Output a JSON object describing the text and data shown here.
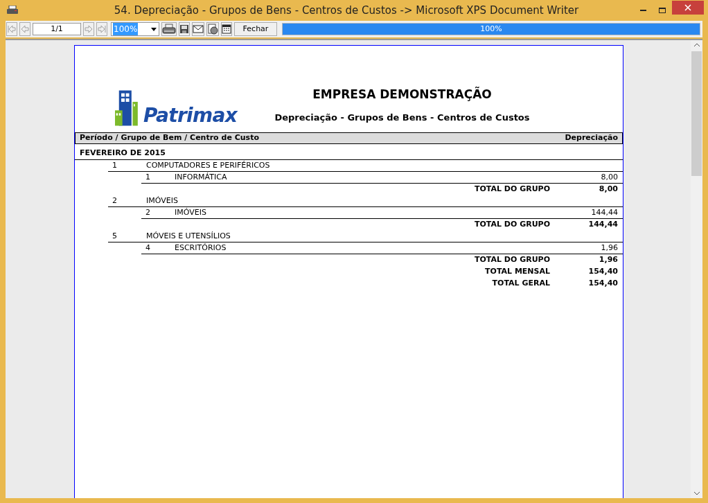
{
  "window": {
    "title": "54. Depreciação - Grupos de Bens - Centros de Custos -> Microsoft XPS Document Writer"
  },
  "toolbar": {
    "page": "1/1",
    "zoom": "100%",
    "close_label": "Fechar",
    "progress": {
      "level": 1,
      "reading": "100%"
    }
  },
  "report": {
    "logo_text": "Patrimax",
    "company": "EMPRESA DEMONSTRAÇÃO",
    "title": "Depreciação - Grupos de Bens - Centros de Custos",
    "columns": [
      "Período / Grupo de Bem / Centro de Custo",
      "Depreciação"
    ],
    "period": "FEVEREIRO DE 2015",
    "groups": [
      {
        "code": "1",
        "name": "COMPUTADORES E PERIFÉRICOS",
        "centers": [
          {
            "code": "1",
            "name": "INFORMÁTICA",
            "value": "8,00"
          }
        ],
        "total_label": "TOTAL DO GRUPO",
        "total": "8,00"
      },
      {
        "code": "2",
        "name": "IMÓVEIS",
        "centers": [
          {
            "code": "2",
            "name": "IMÓVEIS",
            "value": "144,44"
          }
        ],
        "total_label": "TOTAL DO GRUPO",
        "total": "144,44"
      },
      {
        "code": "5",
        "name": "MÓVEIS E UTENSÍLIOS",
        "centers": [
          {
            "code": "4",
            "name": "ESCRITÓRIOS",
            "value": "1,96"
          }
        ],
        "total_label": "TOTAL DO GRUPO",
        "total": "1,96"
      }
    ],
    "totals": [
      {
        "label": "TOTAL MENSAL",
        "value": "154,40"
      },
      {
        "label": "TOTAL GERAL",
        "value": "154,40"
      }
    ]
  }
}
